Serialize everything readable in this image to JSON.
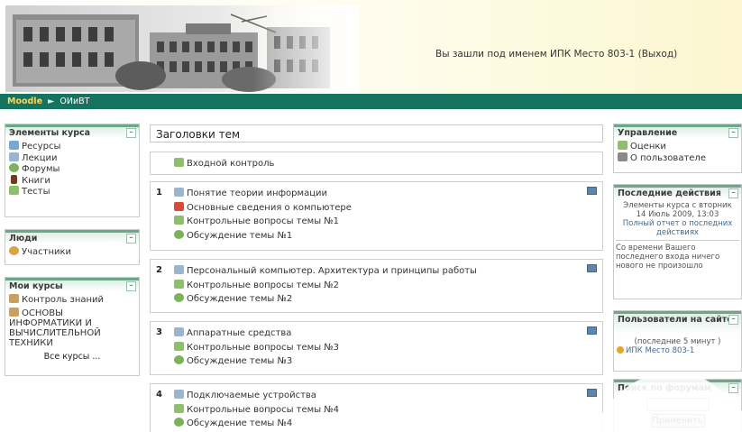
{
  "header": {
    "login_prefix": "Вы зашли под именем",
    "user_name": "ИПК Место 803-1",
    "logout": "(Выход)"
  },
  "navbar": {
    "home": "Moodle",
    "separator": "►",
    "course": "ОИиВТ"
  },
  "left_blocks": {
    "course_elements": {
      "title": "Элементы курса",
      "items": [
        {
          "label": "Ресурсы",
          "icon": "resource-icon"
        },
        {
          "label": "Лекции",
          "icon": "lecture-icon"
        },
        {
          "label": "Форумы",
          "icon": "forum-icon"
        },
        {
          "label": "Книги",
          "icon": "book-icon"
        },
        {
          "label": "Тесты",
          "icon": "quiz-icon"
        }
      ]
    },
    "people": {
      "title": "Люди",
      "items": [
        {
          "label": "Участники",
          "icon": "participants-icon"
        }
      ]
    },
    "my_courses": {
      "title": "Мои курсы",
      "items": [
        {
          "label": "Контроль знаний",
          "icon": "course-icon"
        },
        {
          "label": "ОСНОВЫ ИНФОРМАТИКИ И ВЫЧИСЛИТЕЛЬНОЙ ТЕХНИКИ",
          "icon": "course-icon"
        }
      ],
      "all_courses": "Все курсы ..."
    }
  },
  "main": {
    "title": "Заголовки тем",
    "intro_item": "Входной контроль",
    "topics": [
      {
        "num": "1",
        "items": [
          "Понятие теории информации",
          "Основные сведения о компьютере",
          "Контрольные вопросы темы №1",
          "Обсуждение темы №1"
        ]
      },
      {
        "num": "2",
        "items": [
          "Персональный компьютер. Архитектура и принципы работы",
          "Контрольные вопросы темы №2",
          "Обсуждение темы №2"
        ]
      },
      {
        "num": "3",
        "items": [
          "Аппаратные средства",
          "Контрольные вопросы темы №3",
          "Обсуждение темы №3"
        ]
      },
      {
        "num": "4",
        "items": [
          "Подключаемые устройства",
          "Контрольные вопросы темы №4",
          "Обсуждение темы №4"
        ]
      }
    ]
  },
  "right_blocks": {
    "admin": {
      "title": "Управление",
      "items": [
        {
          "label": "Оценки",
          "icon": "grades-icon"
        },
        {
          "label": "О пользователе",
          "icon": "profile-icon"
        }
      ]
    },
    "recent": {
      "title": "Последние действия",
      "line1": "Элементы курса с вторник",
      "line2": "14 Июль 2009, 13:03",
      "link": "Полный отчет о последних действиях",
      "note": "Со времени Вашего последнего входа ничего нового не произошло"
    },
    "online": {
      "title": "Пользователи на сайте",
      "period": "(последние 5 минут )",
      "user": "ИПК Место 803-1"
    },
    "forum_search": {
      "title": "Поиск по форумам",
      "button": "Применить"
    }
  },
  "colors": {
    "navbar": "#16735f",
    "block_accent": "#6ba789",
    "header_gradient_end": "#fbf6cf"
  }
}
